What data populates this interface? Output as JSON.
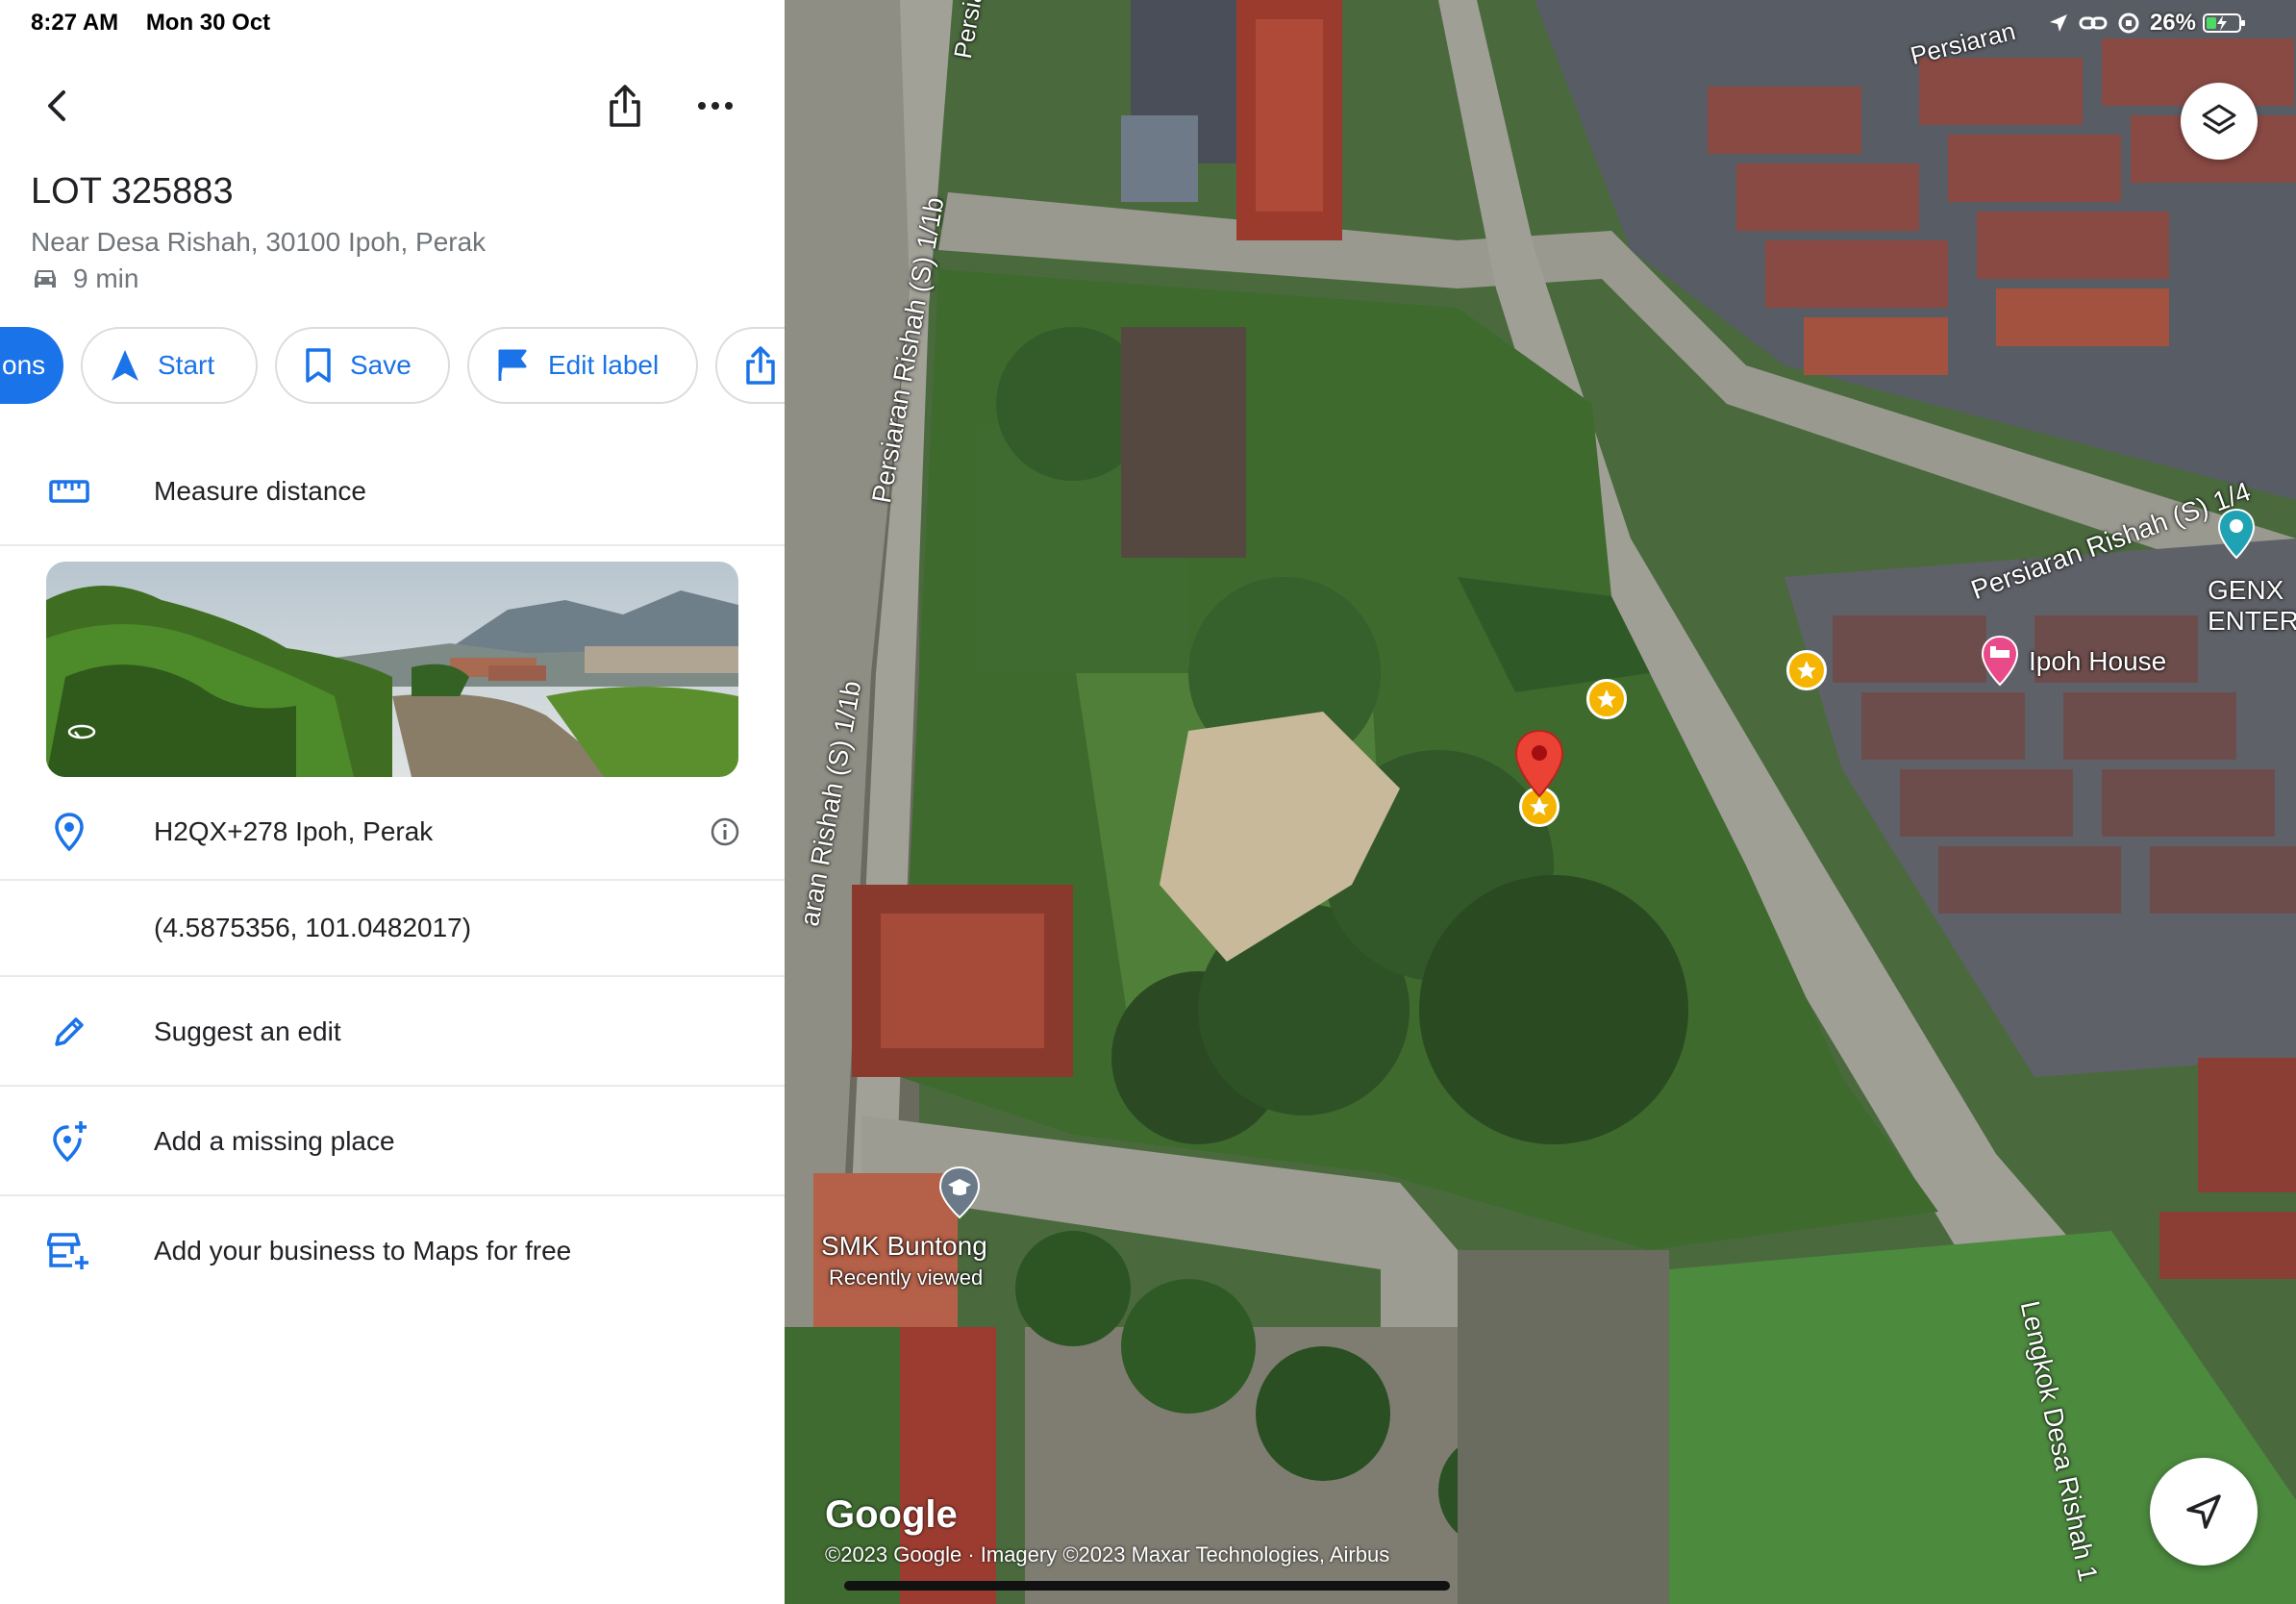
{
  "status_bar": {
    "time": "8:27 AM",
    "date": "Mon 30 Oct",
    "battery": "26%"
  },
  "place": {
    "title": "LOT 325883",
    "address": "Near Desa Rishah, 30100 Ipoh, Perak",
    "eta": "9 min"
  },
  "chips": {
    "directions_partial": "ons",
    "start": "Start",
    "save": "Save",
    "edit_label": "Edit label"
  },
  "list": {
    "measure": "Measure distance",
    "plus_code": "H2QX+278 Ipoh, Perak",
    "coords": "(4.5875356, 101.0482017)",
    "suggest_edit": "Suggest an edit",
    "add_missing": "Add a missing place",
    "add_business": "Add your business to Maps for free"
  },
  "map": {
    "labels": {
      "road_top": "Persia",
      "road_top_right": "Persiaran",
      "road_1_1b_upper": "Persiaran Rishah (S) 1/1b",
      "road_1_1b_lower": "aran Rishah (S) 1/1b",
      "road_1_4": "Persiaran Rishah (S) 1/4",
      "road_lengkok": "Lengkok Desa Rishah 1",
      "genx": "GENX ENTERT",
      "ipoh_house": "Ipoh House",
      "smk": "SMK Buntong",
      "smk_sub": "Recently viewed"
    },
    "google": "Google",
    "attribution": "©2023 Google · Imagery ©2023 Maxar Technologies, Airbus"
  },
  "colors": {
    "accent": "#1a73e8",
    "pin": "#ea4335",
    "star": "#f5b400"
  }
}
